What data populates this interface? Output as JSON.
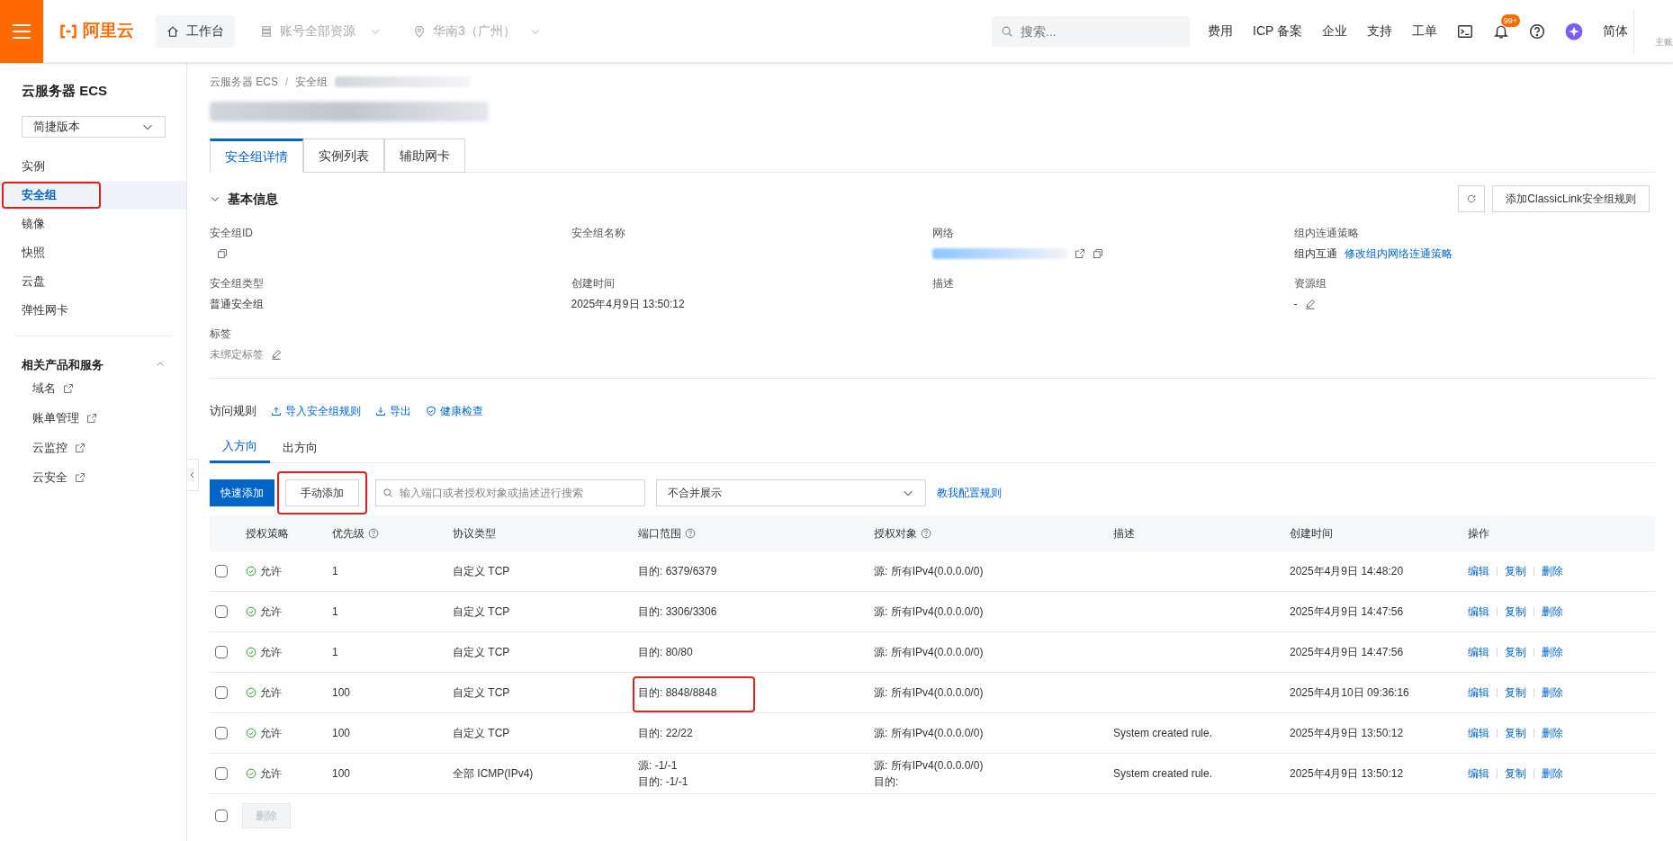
{
  "topbar": {
    "logo": "阿里云",
    "workbench": "工作台",
    "account_scope": "账号全部资源",
    "region": "华南3（广州）",
    "search": {
      "placeholder": "搜索..."
    },
    "links": [
      "费用",
      "ICP 备案",
      "企业",
      "支持",
      "工单"
    ],
    "notification_badge": "99+",
    "language": "简体",
    "account_role": "主账"
  },
  "sidebar": {
    "title": "云服务器 ECS",
    "version_select": "简捷版本",
    "items": [
      {
        "label": "实例",
        "selected": false,
        "annotated": false
      },
      {
        "label": "安全组",
        "selected": true,
        "annotated": true
      },
      {
        "label": "镜像",
        "selected": false,
        "annotated": false
      },
      {
        "label": "快照",
        "selected": false,
        "annotated": false
      },
      {
        "label": "云盘",
        "selected": false,
        "annotated": false
      },
      {
        "label": "弹性网卡",
        "selected": false,
        "annotated": false
      }
    ],
    "related": {
      "title": "相关产品和服务",
      "expanded": true,
      "items": [
        "域名",
        "账单管理",
        "云监控",
        "云安全"
      ]
    }
  },
  "breadcrumb": {
    "items": [
      "云服务器 ECS",
      "安全组"
    ],
    "separator": "/"
  },
  "tabs": [
    {
      "label": "安全组详情",
      "selected": true
    },
    {
      "label": "实例列表",
      "selected": false
    },
    {
      "label": "辅助网卡",
      "selected": false
    }
  ],
  "basic_info": {
    "title": "基本信息",
    "expanded": true,
    "classiclink_button": "添加ClassicLink安全组规则",
    "fields": [
      {
        "label": "安全组ID",
        "kind": "redacted"
      },
      {
        "label": "安全组名称",
        "kind": "redacted"
      },
      {
        "label": "网络",
        "kind": "redacted_link"
      },
      {
        "label": "组内连通策略",
        "kind": "policy",
        "value": "组内互通",
        "link": "修改组内网络连通策略"
      },
      {
        "label": "安全组类型",
        "kind": "text",
        "value": "普通安全组"
      },
      {
        "label": "创建时间",
        "kind": "text",
        "value": "2025年4月9日 13:50:12"
      },
      {
        "label": "描述",
        "kind": "redacted"
      },
      {
        "label": "资源组",
        "kind": "editable",
        "value": "-"
      },
      {
        "label": "标签",
        "kind": "tag",
        "value": "未绑定标签"
      }
    ]
  },
  "rules": {
    "title": "访问规则",
    "actions": [
      "导入安全组规则",
      "导出",
      "健康检查"
    ],
    "directions": [
      {
        "label": "入方向",
        "selected": true
      },
      {
        "label": "出方向",
        "selected": false
      }
    ],
    "quick_add": "快速添加",
    "manual_add": {
      "label": "手动添加",
      "annotated": true
    },
    "search": {
      "placeholder": "输入端口或者授权对象或描述进行搜索"
    },
    "merge_select": "不合并展示",
    "help_link": "教我配置规则",
    "columns": [
      "授权策略",
      "优先级",
      "协议类型",
      "端口范围",
      "授权对象",
      "描述",
      "创建时间",
      "操作"
    ],
    "select_all_checked": false,
    "rows": [
      {
        "checked": false,
        "policy": "允许",
        "priority": "1",
        "protocol": "自定义 TCP",
        "port": [
          "目的: 6379/6379"
        ],
        "port_annotated": false,
        "target": [
          "源: 所有IPv4(0.0.0.0/0)"
        ],
        "created": "2025年4月9日 14:48:20",
        "actions": [
          "编辑",
          "复制",
          "删除"
        ]
      },
      {
        "checked": false,
        "policy": "允许",
        "priority": "1",
        "protocol": "自定义 TCP",
        "port": [
          "目的: 3306/3306"
        ],
        "port_annotated": false,
        "target": [
          "源: 所有IPv4(0.0.0.0/0)"
        ],
        "created": "2025年4月9日 14:47:56",
        "actions": [
          "编辑",
          "复制",
          "删除"
        ]
      },
      {
        "checked": false,
        "policy": "允许",
        "priority": "1",
        "protocol": "自定义 TCP",
        "port": [
          "目的: 80/80"
        ],
        "port_annotated": false,
        "target": [
          "源: 所有IPv4(0.0.0.0/0)"
        ],
        "created": "2025年4月9日 14:47:56",
        "actions": [
          "编辑",
          "复制",
          "删除"
        ]
      },
      {
        "checked": false,
        "policy": "允许",
        "priority": "100",
        "protocol": "自定义 TCP",
        "port": [
          "目的: 8848/8848"
        ],
        "port_annotated": true,
        "target": [
          "源: 所有IPv4(0.0.0.0/0)"
        ],
        "created": "2025年4月10日 09:36:16",
        "actions": [
          "编辑",
          "复制",
          "删除"
        ]
      },
      {
        "checked": false,
        "policy": "允许",
        "priority": "100",
        "protocol": "自定义 TCP",
        "port": [
          "目的: 22/22"
        ],
        "port_annotated": false,
        "target": [
          "源: 所有IPv4(0.0.0.0/0)"
        ],
        "description": "System created rule.",
        "created": "2025年4月9日 13:50:12",
        "actions": [
          "编辑",
          "复制",
          "删除"
        ]
      },
      {
        "checked": false,
        "policy": "允许",
        "priority": "100",
        "protocol": "全部 ICMP(IPv4)",
        "port": [
          "源: -1/-1",
          "目的: -1/-1"
        ],
        "port_annotated": false,
        "target": [
          "源: 所有IPv4(0.0.0.0/0)",
          "目的:"
        ],
        "description": "System created rule.",
        "created": "2025年4月9日 13:50:12",
        "actions": [
          "编辑",
          "复制",
          "删除"
        ]
      }
    ],
    "bulk_delete": {
      "label": "删除",
      "disabled": true
    }
  }
}
